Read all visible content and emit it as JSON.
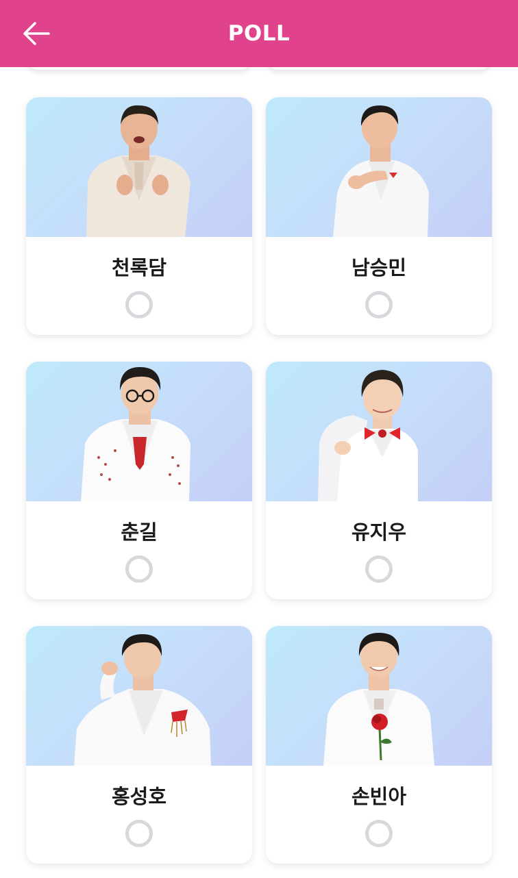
{
  "header": {
    "title": "POLL",
    "back_icon": "arrow-left-icon",
    "background_color": "#e0428c"
  },
  "candidates": [
    {
      "name": "천록담",
      "selected": false,
      "photo": "man-in-cream-suit-finger-hearts"
    },
    {
      "name": "남승민",
      "selected": false,
      "photo": "young-man-in-white-suit-reaching-forward"
    },
    {
      "name": "춘길",
      "selected": false,
      "photo": "man-with-glasses-white-jeweled-suit"
    },
    {
      "name": "유지우",
      "selected": false,
      "photo": "boy-with-red-bow-tie-jacket-over-shoulder"
    },
    {
      "name": "홍성호",
      "selected": false,
      "photo": "man-hand-on-head-white-suit"
    },
    {
      "name": "손빈아",
      "selected": false,
      "photo": "man-holding-red-rose-white-suit"
    }
  ]
}
